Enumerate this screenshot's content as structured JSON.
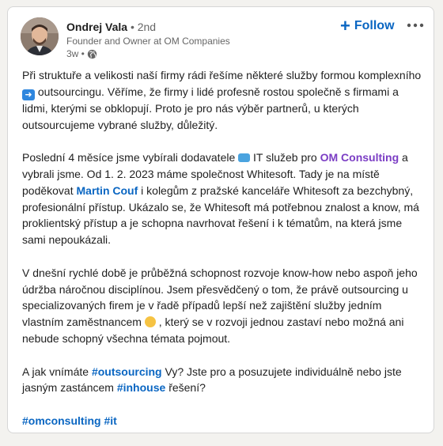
{
  "post": {
    "author": {
      "name": "Ondrej Vala",
      "degree": "• 2nd",
      "headline": "Founder and Owner at OM Companies",
      "time": "3w •"
    },
    "follow_label": "Follow",
    "paragraphs": {
      "p1": {
        "a": "Při struktuře a velikosti naší firmy rádi řešíme některé služby formou komplexního",
        "b": "outsourcingu. Věříme, že firmy i lidé profesně rostou společně s firmami a lidmi, kterými se obklopují. Proto je pro nás výběr partnerů, u kterých outsourcujeme vybrané služby, důležitý."
      },
      "p2": {
        "a": "Poslední 4 měsíce jsme vybírali dodavatele",
        "b": "IT služeb pro",
        "company": "OM Consulting",
        "c": "a vybrali jsme. Od 1. 2. 2023 máme společnost Whitesoft. Tady je na místě poděkovat",
        "person": "Martin Couf",
        "d": "i kolegům z pražské kanceláře Whitesoft za bezchybný, profesionální přístup. Ukázalo se, že Whitesoft má potřebnou znalost a know, má proklientský přístup a je schopna navrhovat řešení i k tématům, na která jsme sami nepoukázali."
      },
      "p3": {
        "a": "V dnešní rychlé době je průběžná schopnost rozvoje know-how nebo aspoň jeho údržba náročnou disciplínou. Jsem přesvědčený o tom, že právě outsourcing u specializovaných firem je v řadě případů lepší než zajištění služby jedním vlastním zaměstnancem",
        "b": ", který se v rozvoji jednou zastaví nebo možná ani nebude schopný všechna témata pojmout."
      },
      "p4": {
        "a": "A jak vnímáte",
        "tag1": "#outsourcing",
        "b": "Vy? Jste pro a posuzujete individuálně nebo jste jasným zastáncem",
        "tag2": "#inhouse",
        "c": "řešení?"
      },
      "p5": {
        "tag1": "#omconsulting",
        "tag2": "#it"
      }
    }
  },
  "icons": {
    "follow": "plus-icon",
    "more": "ellipsis-icon",
    "visibility": "globe-icon",
    "arrow": "right-arrow-emoji",
    "laptop": "laptop-emoji",
    "face": "smiling-face-emoji"
  },
  "colors": {
    "link": "#0a66c2",
    "company": "#7b3dc4",
    "text": "#1f1f1f",
    "muted": "#666666"
  }
}
